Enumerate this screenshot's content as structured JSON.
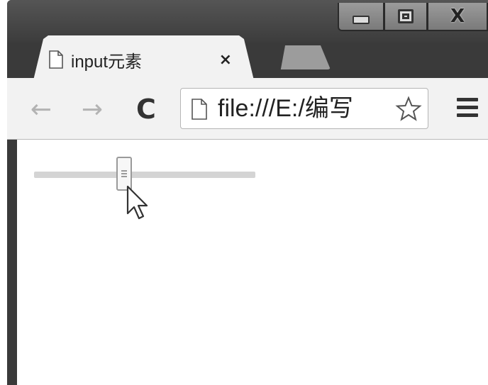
{
  "window": {
    "controls": {
      "minimize_icon": "minimize-icon",
      "maximize_icon": "maximize-icon",
      "close_icon": "close-icon",
      "close_label": "X"
    }
  },
  "tabs": [
    {
      "title": "input元素",
      "icon": "page-icon",
      "close_label": "×",
      "active": true
    }
  ],
  "toolbar": {
    "back_label": "←",
    "forward_label": "→",
    "reload_label": "C",
    "address": {
      "icon": "page-icon",
      "url": "file:///E:/编写"
    },
    "bookmark_icon": "star-icon",
    "menu_icon": "menu-icon"
  },
  "page": {
    "range_input": {
      "value": 0.4
    }
  },
  "colors": {
    "chrome_dark": "#3a3a3a",
    "toolbar_bg": "#f2f2f2",
    "track": "#d4d4d4"
  }
}
